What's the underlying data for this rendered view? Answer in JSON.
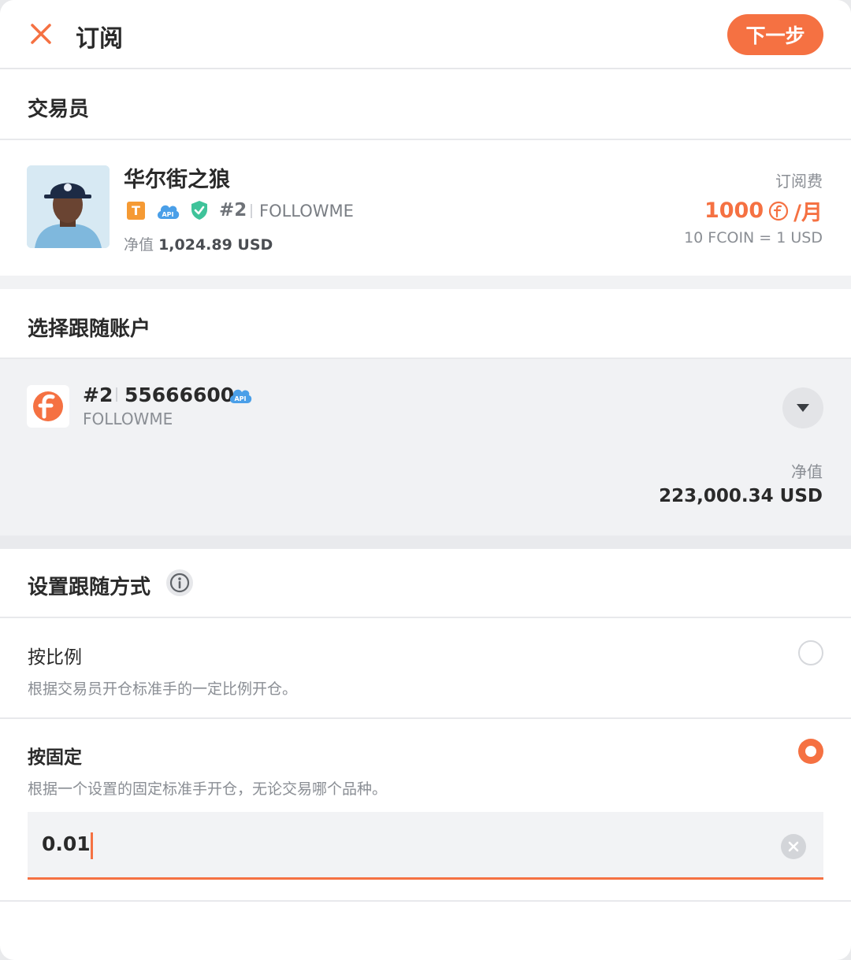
{
  "header": {
    "title": "订阅",
    "next_label": "下一步"
  },
  "trader_section": {
    "title": "交易员",
    "name": "华尔街之狼",
    "badge_t": "T",
    "api_badge": "API",
    "rank": "#2",
    "broker": "FOLLOWME",
    "nav_label": "净值",
    "nav_value": "1,024.89 USD",
    "fee_label": "订阅费",
    "fee_amount": "1000",
    "fee_unit": "/月",
    "rate": "10 FCOIN = 1 USD"
  },
  "account_section": {
    "title": "选择跟随账户",
    "rank": "#2",
    "account_number": "55666600",
    "api_badge": "API",
    "broker": "FOLLOWME",
    "nav_label": "净值",
    "nav_value": "223,000.34 USD"
  },
  "mode_section": {
    "title": "设置跟随方式",
    "options": [
      {
        "title": "按比例",
        "desc": "根据交易员开仓标准手的一定比例开仓。",
        "selected": false
      },
      {
        "title": "按固定",
        "desc": "根据一个设置的固定标准手开仓，无论交易哪个品种。",
        "selected": true
      }
    ],
    "fixed_lot_value": "0.01"
  },
  "colors": {
    "accent": "#f57142",
    "api_blue": "#4a9fe8",
    "shield_green": "#3fc39a",
    "gold": "#f59a34"
  },
  "icons": [
    "close-icon",
    "api-icon",
    "shield-check-icon",
    "fcoin-icon",
    "followme-logo-icon",
    "chevron-down-icon",
    "info-icon",
    "clear-icon"
  ]
}
